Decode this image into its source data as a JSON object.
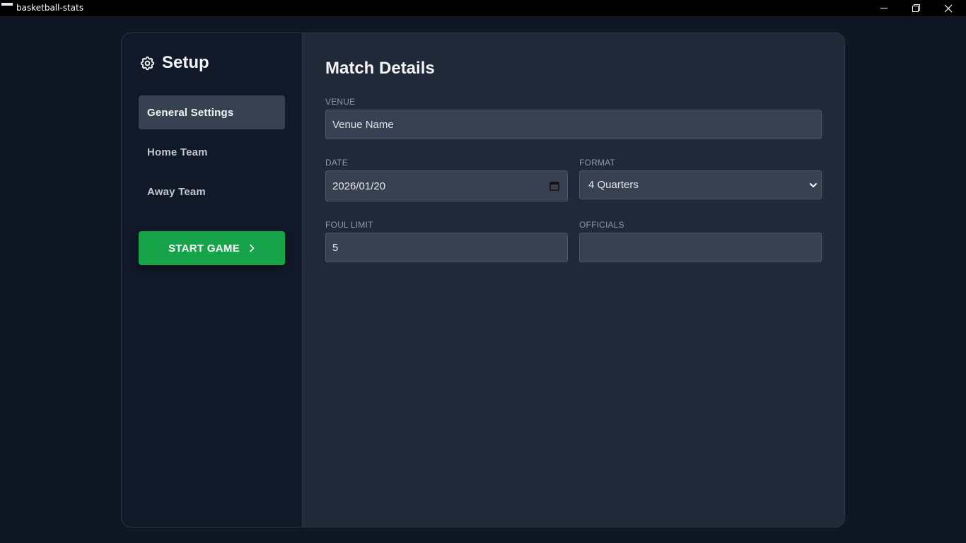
{
  "window": {
    "title": "basketball-stats",
    "minimize_glyph": "─",
    "maximize_glyph": "❐",
    "close_glyph": "✕"
  },
  "sidebar": {
    "heading": "Setup",
    "heading_icon": "gear-icon",
    "items": [
      {
        "label": "General Settings",
        "active": true
      },
      {
        "label": "Home Team",
        "active": false
      },
      {
        "label": "Away Team",
        "active": false
      }
    ],
    "start_button": {
      "label": "START GAME",
      "icon": "chevron-right-icon"
    }
  },
  "main": {
    "title": "Match Details",
    "venue": {
      "label": "VENUE",
      "placeholder": "Venue Name",
      "value": ""
    },
    "date": {
      "label": "DATE",
      "value": "2026/01/20"
    },
    "format": {
      "label": "FORMAT",
      "selected": "4 Quarters"
    },
    "foul_limit": {
      "label": "FOUL LIMIT",
      "value": "5"
    },
    "officials": {
      "label": "OFFICIALS",
      "value": ""
    }
  },
  "colors": {
    "background": "#0f1724",
    "panel": "#1f2937",
    "sidebar": "#111827",
    "accent_green": "#16a34a",
    "input_bg": "#374151"
  }
}
